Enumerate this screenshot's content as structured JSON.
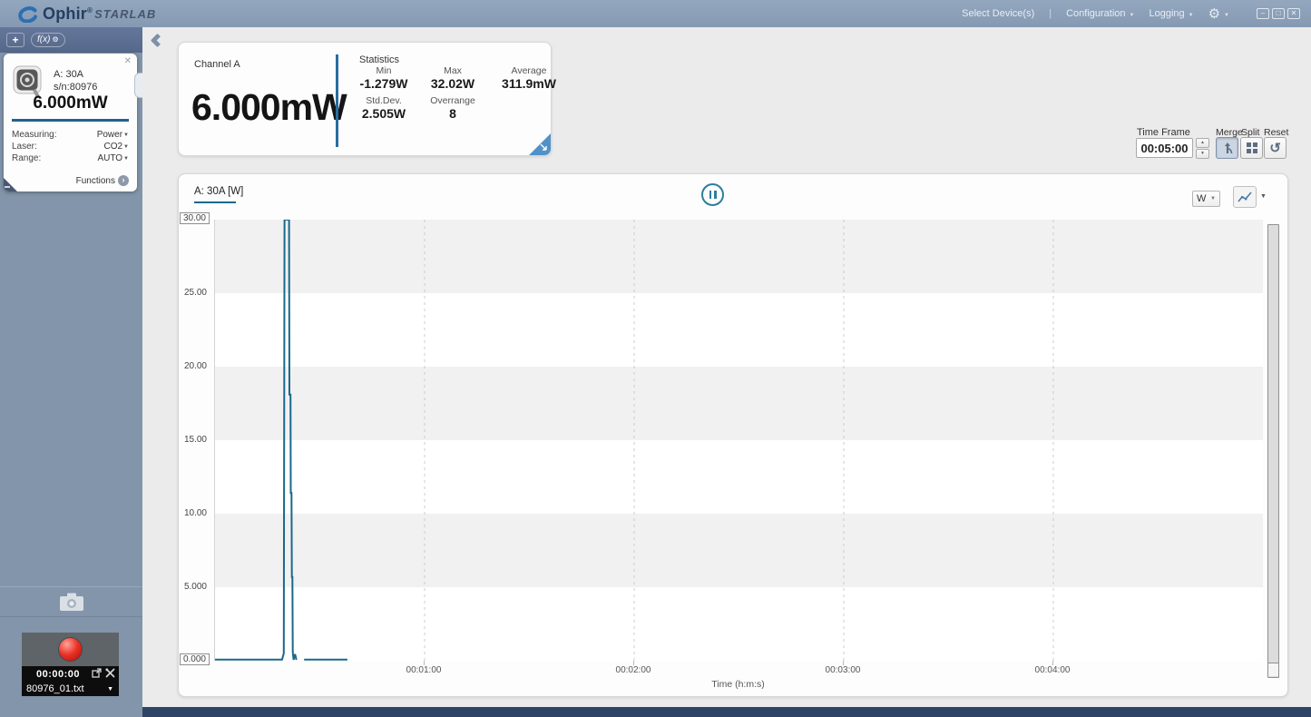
{
  "app": {
    "brand": "Ophir",
    "brand_reg": "®",
    "brand_sub": "STARLAB",
    "menu": {
      "select_devices": "Select Device(s)",
      "separator": "|",
      "configuration": "Configuration",
      "logging": "Logging",
      "gear_glyph": "⚙",
      "caret_glyph": "▼"
    },
    "window_buttons": {
      "minimize": "–",
      "restore": "□",
      "close": "✕"
    }
  },
  "colors": {
    "accent_blue": "#1f628e",
    "chart_line": "#19698a",
    "record_red": "#e02718"
  },
  "sidebar": {
    "add_button": "+",
    "fx_button": "f(x)",
    "fx_gear": "⚙",
    "device": {
      "close_glyph": "✕",
      "name": "A: 30A",
      "serial": "s/n:80976",
      "reading": "6.000mW",
      "rows": [
        {
          "label": "Measuring:",
          "value": "Power"
        },
        {
          "label": "Laser:",
          "value": "CO2"
        },
        {
          "label": "Range:",
          "value": "AUTO"
        }
      ],
      "functions_label": "Functions",
      "functions_arrow": "›"
    },
    "recording": {
      "timer": "00:00:00",
      "filename": "80976_01.txt",
      "caret_glyph": "▼"
    }
  },
  "stats_panel": {
    "title": "Channel A",
    "reading": "6.000mW",
    "stats_title": "Statistics",
    "stats": [
      {
        "label": "Min",
        "value": "-1.279W"
      },
      {
        "label": "Max",
        "value": "32.02W"
      },
      {
        "label": "Average",
        "value": "311.9mW"
      },
      {
        "label": "Std.Dev.",
        "value": "2.505W"
      },
      {
        "label": "Overrange",
        "value": "8"
      }
    ]
  },
  "toolbar": {
    "time_frame_label": "Time Frame",
    "time_frame_value": "00:05:00",
    "merge_label": "Merge",
    "split_label": "Split",
    "reset_label": "Reset",
    "reset_glyph": "↺"
  },
  "chart": {
    "title": "A: 30A [W]",
    "unit_selector": "W",
    "unit_caret": "▼",
    "type_caret": "▼"
  },
  "chart_data": {
    "type": "line",
    "title": "A: 30A [W]",
    "xlabel": "Time (h:m:s)",
    "ylabel": "W",
    "xlim_seconds": [
      0,
      300
    ],
    "ylim": [
      0,
      30
    ],
    "grid": "vertical-dashed",
    "band_colors": [
      "#f2f1f1",
      "#ffffff"
    ],
    "line_color": "#19698a",
    "yticks": [
      {
        "v": 30,
        "label": "30.00",
        "boxed": true
      },
      {
        "v": 25,
        "label": "25.00"
      },
      {
        "v": 20,
        "label": "20.00"
      },
      {
        "v": 15,
        "label": "15.00"
      },
      {
        "v": 10,
        "label": "10.00"
      },
      {
        "v": 5,
        "label": "5.000"
      },
      {
        "v": 0,
        "label": "0.000",
        "boxed": true
      }
    ],
    "xticks": [
      {
        "t": 60,
        "label": "00:01:00"
      },
      {
        "t": 120,
        "label": "00:02:00"
      },
      {
        "t": 180,
        "label": "00:03:00"
      },
      {
        "t": 240,
        "label": "00:04:00"
      }
    ],
    "series": [
      {
        "name": "A: 30A",
        "unit": "W",
        "segments": [
          [
            [
              0,
              0.08
            ],
            [
              19.2,
              0.08
            ],
            [
              19.7,
              0.5
            ],
            [
              19.9,
              32.02
            ],
            [
              21.2,
              32.02
            ],
            [
              21.3,
              18.1
            ],
            [
              21.6,
              18.1
            ],
            [
              21.7,
              11.4
            ],
            [
              21.9,
              11.4
            ],
            [
              22.0,
              5.7
            ],
            [
              22.15,
              5.7
            ],
            [
              22.25,
              0.6
            ],
            [
              22.5,
              0.06
            ],
            [
              22.9,
              0.45
            ],
            [
              23.3,
              0.06
            ]
          ],
          [
            [
              25.5,
              0.08
            ],
            [
              37.9,
              0.08
            ]
          ]
        ]
      }
    ]
  }
}
